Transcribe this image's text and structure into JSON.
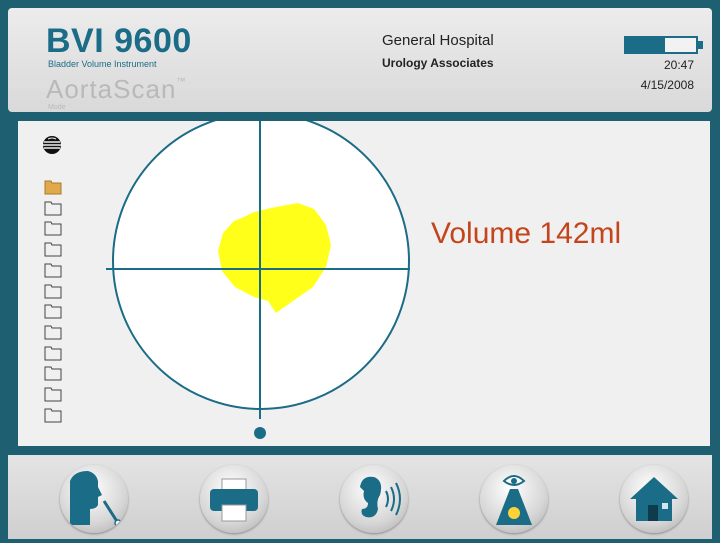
{
  "header": {
    "brand_title": "BVI 9600",
    "brand_subtitle": "Bladder Volume Instrument",
    "mode_name": "AortaScan",
    "mode_trademark": "™",
    "mode_label": "Mode",
    "hospital": "General Hospital",
    "clinic": "Urology Associates",
    "battery_level": 0.55,
    "time": "20:47",
    "date": "4/15/2008"
  },
  "scan": {
    "volume_text": "Volume 142ml",
    "probe_icon": "probe-icon",
    "folders": [
      {
        "icon": "folder-icon",
        "state": "filled"
      },
      {
        "icon": "folder-icon",
        "state": "empty"
      },
      {
        "icon": "folder-icon",
        "state": "empty"
      },
      {
        "icon": "folder-icon",
        "state": "empty"
      },
      {
        "icon": "folder-icon",
        "state": "empty"
      },
      {
        "icon": "folder-icon",
        "state": "empty"
      },
      {
        "icon": "folder-icon",
        "state": "empty"
      },
      {
        "icon": "folder-icon",
        "state": "empty"
      },
      {
        "icon": "folder-icon",
        "state": "empty"
      },
      {
        "icon": "folder-icon",
        "state": "empty"
      },
      {
        "icon": "folder-icon",
        "state": "empty"
      },
      {
        "icon": "folder-icon",
        "state": "empty"
      }
    ]
  },
  "toolbar": {
    "buttons": [
      {
        "name": "voice-button",
        "icon": "speaking-head-icon"
      },
      {
        "name": "print-button",
        "icon": "printer-icon"
      },
      {
        "name": "sound-button",
        "icon": "ear-icon"
      },
      {
        "name": "aim-button",
        "icon": "eye-light-icon"
      },
      {
        "name": "home-button",
        "icon": "house-icon"
      }
    ]
  },
  "colors": {
    "frame": "#1e5f72",
    "brand": "#1b6c86",
    "crosshair": "#1b6c86",
    "bladder": "#ffff1a",
    "volume_text": "#c4441c",
    "folder_filled": "#e0a94c"
  }
}
